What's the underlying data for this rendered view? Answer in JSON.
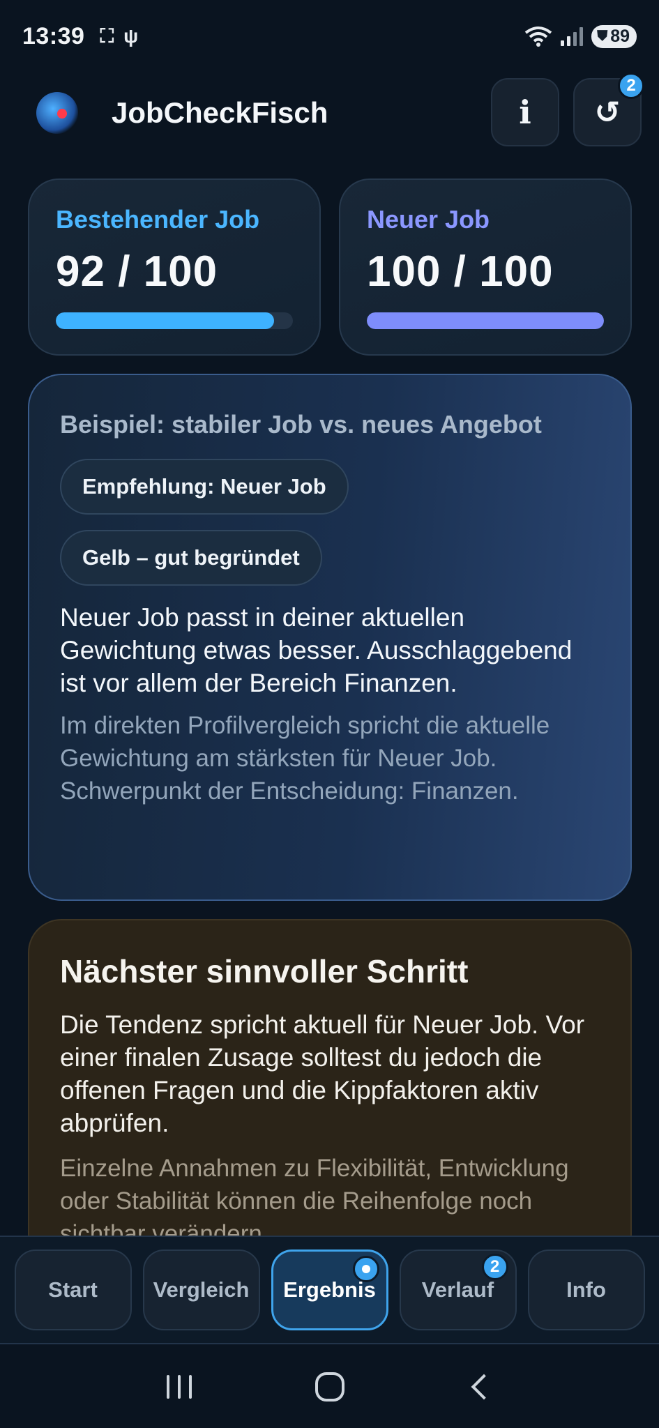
{
  "status_bar": {
    "time": "13:39",
    "wifi_label": "6",
    "battery": "89"
  },
  "header": {
    "title": "JobCheckFisch",
    "info_label": "i",
    "reset_label": "↺",
    "reset_badge": "2"
  },
  "scores": {
    "current": {
      "label": "Bestehender Job",
      "value": "92 / 100",
      "progress_fraction": 0.92,
      "color": "#3eb2ff"
    },
    "new": {
      "label": "Neuer Job",
      "value": "100 / 100",
      "progress_fraction": 1.0,
      "color": "#7e8dfb"
    }
  },
  "result": {
    "subtitle": "Beispiel: stabiler Job vs. neues Angebot",
    "recommendation_chip": "Empfehlung: Neuer Job",
    "confidence_chip": "Gelb – gut begründet",
    "main_text": "Neuer Job passt in deiner aktuellen Gewichtung etwas besser. Ausschlaggebend ist vor allem der Bereich Finanzen.",
    "detail_text": "Im direkten Profilvergleich spricht die aktuelle Gewichtung am stärksten für Neuer Job. Schwerpunkt der Entscheidung: Finanzen."
  },
  "next_step": {
    "title": "Nächster sinnvoller Schritt",
    "main_text": "Die Tendenz spricht aktuell für Neuer Job. Vor einer finalen Zusage solltest du jedoch die offenen Fragen und die Kippfaktoren aktiv abprüfen.",
    "detail_text": "Einzelne Annahmen zu Flexibilität, Entwicklung oder Stabilität können die Reihenfolge noch sichtbar verändern."
  },
  "bottom_nav": {
    "items": [
      {
        "label": "Start"
      },
      {
        "label": "Vergleich"
      },
      {
        "label": "Ergebnis"
      },
      {
        "label": "Verlauf",
        "badge": "2"
      },
      {
        "label": "Info"
      }
    ],
    "active": "Ergebnis"
  },
  "colors": {
    "accent": "#3fa4ec",
    "background": "#0a1420"
  }
}
